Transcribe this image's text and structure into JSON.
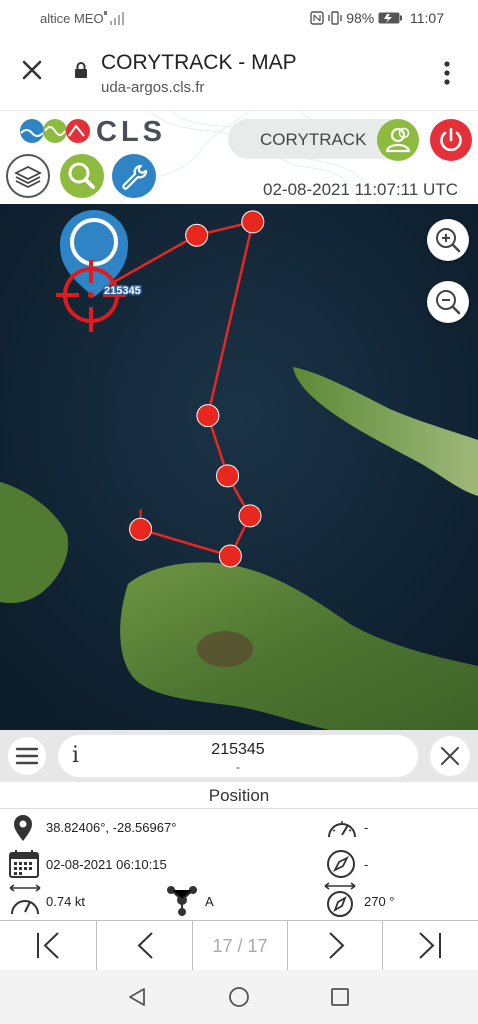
{
  "status_bar": {
    "carrier": "altice MEO",
    "battery": "98%",
    "time": "11:07"
  },
  "browser": {
    "title": "CORYTRACK - MAP",
    "url": "uda-argos.cls.fr"
  },
  "app": {
    "logo_text": "CLS",
    "user_name": "CORYTRACK",
    "datetime": "02-08-2021 11:07:11 UTC"
  },
  "map": {
    "marker_id": "215345",
    "track_points": [
      [
        38.82406,
        -28.56967
      ],
      [
        38.833,
        -28.532
      ],
      [
        38.835,
        -28.512
      ],
      [
        38.806,
        -28.528
      ],
      [
        38.797,
        -28.521
      ],
      [
        38.791,
        -28.513
      ],
      [
        38.785,
        -28.52
      ],
      [
        38.789,
        -28.552
      ]
    ]
  },
  "panel": {
    "info_badge": "i",
    "id": "215345",
    "sub": "-",
    "heading": "Position",
    "coords": "38.82406°, -28.56967°",
    "date": "02-08-2021 06:10:15",
    "speed": "0.74 kt",
    "gauge_value": "-",
    "compass_value": "-",
    "class": "A",
    "heading_value": "270 °"
  },
  "nav": {
    "page": "17 / 17"
  },
  "colors": {
    "track": "#e8281f",
    "accent_green": "#8dbb3f",
    "accent_red": "#e33039",
    "accent_blue": "#2f84c6"
  }
}
